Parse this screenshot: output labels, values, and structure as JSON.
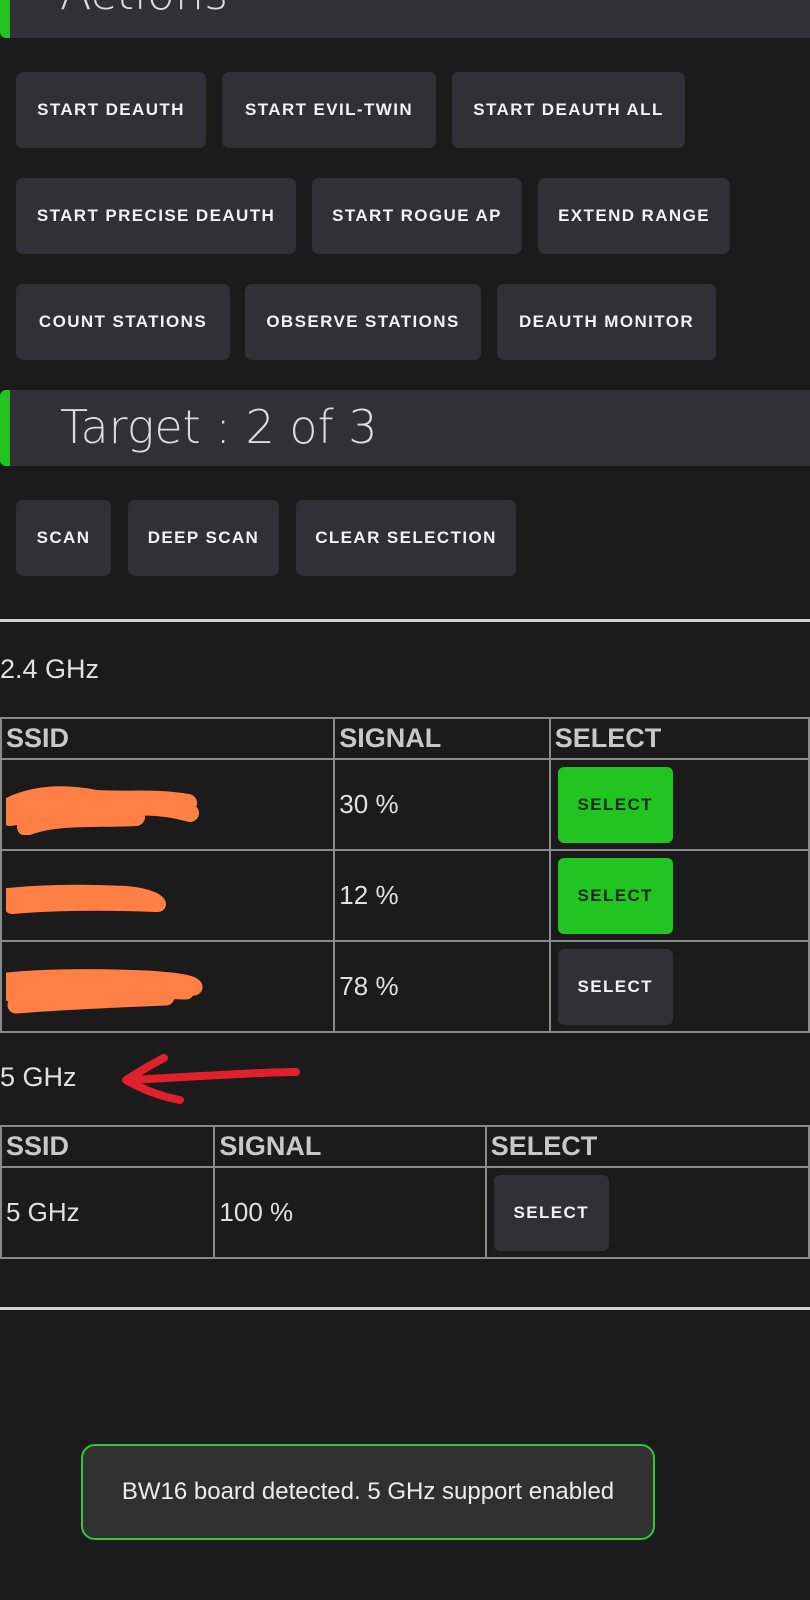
{
  "actions": {
    "title": "Actions",
    "buttons": [
      "START DEAUTH",
      "START EVIL-TWIN",
      "START DEAUTH ALL",
      "START PRECISE DEAUTH",
      "START ROGUE AP",
      "EXTEND RANGE",
      "COUNT STATIONS",
      "OBSERVE STATIONS",
      "DEAUTH MONITOR"
    ]
  },
  "target": {
    "title": "Target : 2 of 3",
    "buttons": [
      "SCAN",
      "DEEP SCAN",
      "CLEAR SELECTION"
    ]
  },
  "band_24": {
    "label": "2.4 GHz",
    "headers": [
      "SSID",
      "SIGNAL",
      "SELECT"
    ],
    "rows": [
      {
        "ssid": "",
        "signal": "30 %",
        "select_label": "SELECT",
        "selected": true
      },
      {
        "ssid": "",
        "signal": "12 %",
        "select_label": "SELECT",
        "selected": true
      },
      {
        "ssid": "",
        "signal": "78 %",
        "select_label": "SELECT",
        "selected": false
      }
    ]
  },
  "band_5": {
    "label": "5 GHz",
    "headers": [
      "SSID",
      "SIGNAL",
      "SELECT"
    ],
    "rows": [
      {
        "ssid": "5 GHz",
        "signal": "100 %",
        "select_label": "SELECT",
        "selected": false
      }
    ]
  },
  "toast": {
    "message": "BW16 board detected. 5 GHz support enabled"
  },
  "colors": {
    "accent_green": "#22c422",
    "button_bg": "#303036",
    "page_bg": "#1b1b1b",
    "redaction_orange": "#ff7f45",
    "annotation_red": "#e0202a"
  }
}
